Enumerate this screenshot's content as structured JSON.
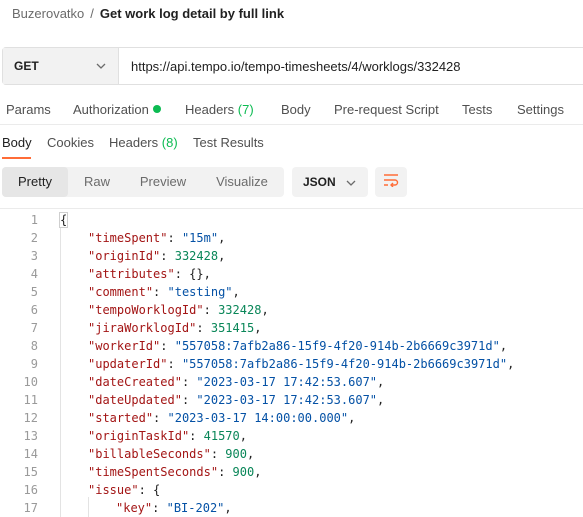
{
  "breadcrumb": {
    "parent": "Buzerovatko",
    "separator": "/",
    "current": "Get work log detail by full link"
  },
  "request": {
    "method": "GET",
    "url": "https://api.tempo.io/tempo-timesheets/4/worklogs/332428"
  },
  "request_tabs": [
    {
      "label": "Params"
    },
    {
      "label": "Authorization",
      "dot_color": "#0cbb52"
    },
    {
      "label": "Headers",
      "count": "(7)"
    },
    {
      "label": "Body"
    },
    {
      "label": "Pre-request Script"
    },
    {
      "label": "Tests"
    },
    {
      "label": "Settings"
    }
  ],
  "response_tabs": [
    {
      "label": "Body",
      "active": true
    },
    {
      "label": "Cookies"
    },
    {
      "label": "Headers",
      "count": "(8)"
    },
    {
      "label": "Test Results"
    }
  ],
  "view_modes": [
    {
      "label": "Pretty",
      "active": true
    },
    {
      "label": "Raw"
    },
    {
      "label": "Preview"
    },
    {
      "label": "Visualize"
    }
  ],
  "format": "JSON",
  "colors": {
    "accent": "#ff6c37",
    "success": "#0cbb52",
    "json_key": "#a31515",
    "json_string": "#0451a5",
    "json_number": "#098658"
  },
  "icons": {
    "dropdown": "chevron-down-icon",
    "wrap": "wrap-lines-icon",
    "status_dot": "status-dot-icon"
  },
  "code_lines": [
    {
      "n": "1",
      "indent": 0,
      "text": "{"
    },
    {
      "n": "2",
      "indent": 1,
      "key": "timeSpent",
      "value": "\"15m\"",
      "vtype": "s",
      "trail": ","
    },
    {
      "n": "3",
      "indent": 1,
      "key": "originId",
      "value": "332428",
      "vtype": "n",
      "trail": ","
    },
    {
      "n": "4",
      "indent": 1,
      "key": "attributes",
      "value": "{}",
      "vtype": "p",
      "trail": ","
    },
    {
      "n": "5",
      "indent": 1,
      "key": "comment",
      "value": "\"testing\"",
      "vtype": "s",
      "trail": ","
    },
    {
      "n": "6",
      "indent": 1,
      "key": "tempoWorklogId",
      "value": "332428",
      "vtype": "n",
      "trail": ","
    },
    {
      "n": "7",
      "indent": 1,
      "key": "jiraWorklogId",
      "value": "351415",
      "vtype": "n",
      "trail": ","
    },
    {
      "n": "8",
      "indent": 1,
      "key": "workerId",
      "value": "\"557058:7afb2a86-15f9-4f20-914b-2b6669c3971d\"",
      "vtype": "s",
      "trail": ","
    },
    {
      "n": "9",
      "indent": 1,
      "key": "updaterId",
      "value": "\"557058:7afb2a86-15f9-4f20-914b-2b6669c3971d\"",
      "vtype": "s",
      "trail": ","
    },
    {
      "n": "10",
      "indent": 1,
      "key": "dateCreated",
      "value": "\"2023-03-17 17:42:53.607\"",
      "vtype": "s",
      "trail": ","
    },
    {
      "n": "11",
      "indent": 1,
      "key": "dateUpdated",
      "value": "\"2023-03-17 17:42:53.607\"",
      "vtype": "s",
      "trail": ","
    },
    {
      "n": "12",
      "indent": 1,
      "key": "started",
      "value": "\"2023-03-17 14:00:00.000\"",
      "vtype": "s",
      "trail": ","
    },
    {
      "n": "13",
      "indent": 1,
      "key": "originTaskId",
      "value": "41570",
      "vtype": "n",
      "trail": ","
    },
    {
      "n": "14",
      "indent": 1,
      "key": "billableSeconds",
      "value": "900",
      "vtype": "n",
      "trail": ","
    },
    {
      "n": "15",
      "indent": 1,
      "key": "timeSpentSeconds",
      "value": "900",
      "vtype": "n",
      "trail": ","
    },
    {
      "n": "16",
      "indent": 1,
      "key": "issue",
      "value": "{",
      "vtype": "p",
      "trail": ""
    },
    {
      "n": "17",
      "indent": 2,
      "key": "key",
      "value": "\"BI-202\"",
      "vtype": "s",
      "trail": ","
    }
  ]
}
